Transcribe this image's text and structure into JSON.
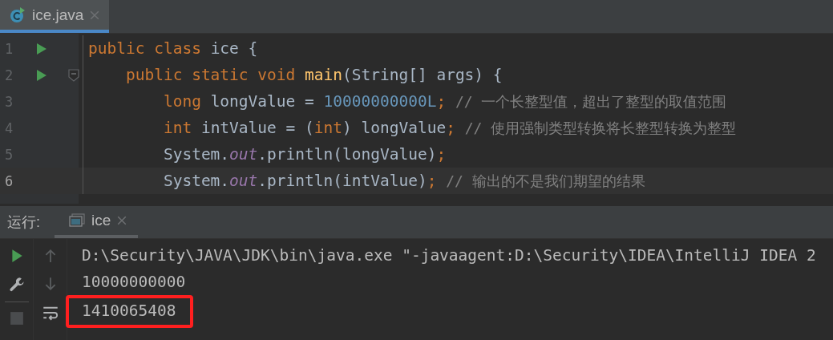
{
  "editor_tabs": [
    {
      "label": "ice.java",
      "selected": true
    }
  ],
  "editor": {
    "lines": [
      {
        "number": "1",
        "run": true,
        "fold": false,
        "current": false,
        "tokens": [
          {
            "kind": "keyword",
            "text": "public class "
          },
          {
            "kind": "plain",
            "text": "ice {"
          }
        ]
      },
      {
        "number": "2",
        "run": true,
        "fold": true,
        "current": false,
        "tokens": [
          {
            "kind": "keyword",
            "text": "    public static void "
          },
          {
            "kind": "method",
            "text": "main"
          },
          {
            "kind": "plain",
            "text": "(String[] args) {"
          }
        ]
      },
      {
        "number": "3",
        "run": false,
        "fold": false,
        "current": false,
        "tokens": [
          {
            "kind": "keyword",
            "text": "        long "
          },
          {
            "kind": "plain",
            "text": "longValue = "
          },
          {
            "kind": "number",
            "text": "10000000000L"
          },
          {
            "kind": "keyword",
            "text": "; "
          },
          {
            "kind": "comment",
            "text": "// 一个长整型值，超出了整型的取值范围"
          }
        ]
      },
      {
        "number": "4",
        "run": false,
        "fold": false,
        "current": false,
        "tokens": [
          {
            "kind": "keyword",
            "text": "        int "
          },
          {
            "kind": "plain",
            "text": "intValue = ("
          },
          {
            "kind": "keyword",
            "text": "int"
          },
          {
            "kind": "plain",
            "text": ") longValue"
          },
          {
            "kind": "keyword",
            "text": "; "
          },
          {
            "kind": "comment",
            "text": "// 使用强制类型转换将长整型转换为整型"
          }
        ]
      },
      {
        "number": "5",
        "run": false,
        "fold": false,
        "current": false,
        "tokens": [
          {
            "kind": "plain",
            "text": "        System."
          },
          {
            "kind": "field",
            "text": "out"
          },
          {
            "kind": "plain",
            "text": ".println(longValue)"
          },
          {
            "kind": "keyword",
            "text": ";"
          }
        ]
      },
      {
        "number": "6",
        "run": false,
        "fold": false,
        "current": true,
        "tokens": [
          {
            "kind": "plain",
            "text": "        System."
          },
          {
            "kind": "field",
            "text": "out"
          },
          {
            "kind": "plain",
            "text": ".println(intValue)"
          },
          {
            "kind": "keyword",
            "text": "; "
          },
          {
            "kind": "comment",
            "text": "// 输出的不是我们期望的结果"
          }
        ]
      }
    ]
  },
  "run_panel": {
    "label": "运行:",
    "tabs": [
      {
        "label": "ice",
        "selected": true
      }
    ],
    "console": [
      {
        "text": "D:\\Security\\JAVA\\JDK\\bin\\java.exe \"-javaagent:D:\\Security\\IDEA\\IntelliJ IDEA 2",
        "annotated": false
      },
      {
        "text": "10000000000",
        "annotated": false
      },
      {
        "text": "1410065408",
        "annotated": true
      }
    ]
  }
}
